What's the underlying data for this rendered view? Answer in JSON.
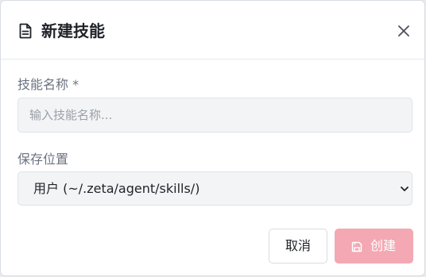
{
  "dialog": {
    "title": "新建技能",
    "title_icon": "document-icon",
    "close_icon": "close-icon"
  },
  "form": {
    "name_label": "技能名称 *",
    "name_placeholder": "输入技能名称...",
    "name_value": "",
    "location_label": "保存位置",
    "location_selected": "用户 (~/.zeta/agent/skills/)"
  },
  "actions": {
    "cancel_label": "取消",
    "create_label": "创建",
    "create_icon": "save-icon",
    "create_color": "#f3a8b3"
  }
}
